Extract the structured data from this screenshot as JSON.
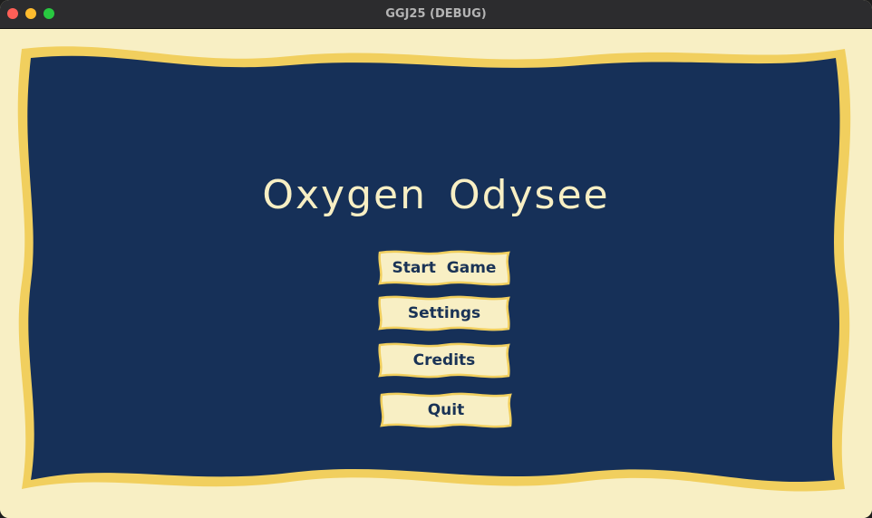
{
  "window": {
    "title": "GGJ25 (DEBUG)"
  },
  "menu": {
    "title": "Oxygen Odysee",
    "buttons": [
      {
        "label": "Start Game"
      },
      {
        "label": "Settings"
      },
      {
        "label": "Credits"
      },
      {
        "label": "Quit"
      }
    ]
  },
  "colors": {
    "background": "#f8efc4",
    "panel": "#163058",
    "border": "#f1cf5e",
    "button_fill": "#f8efc4",
    "button_text": "#1a3356"
  }
}
